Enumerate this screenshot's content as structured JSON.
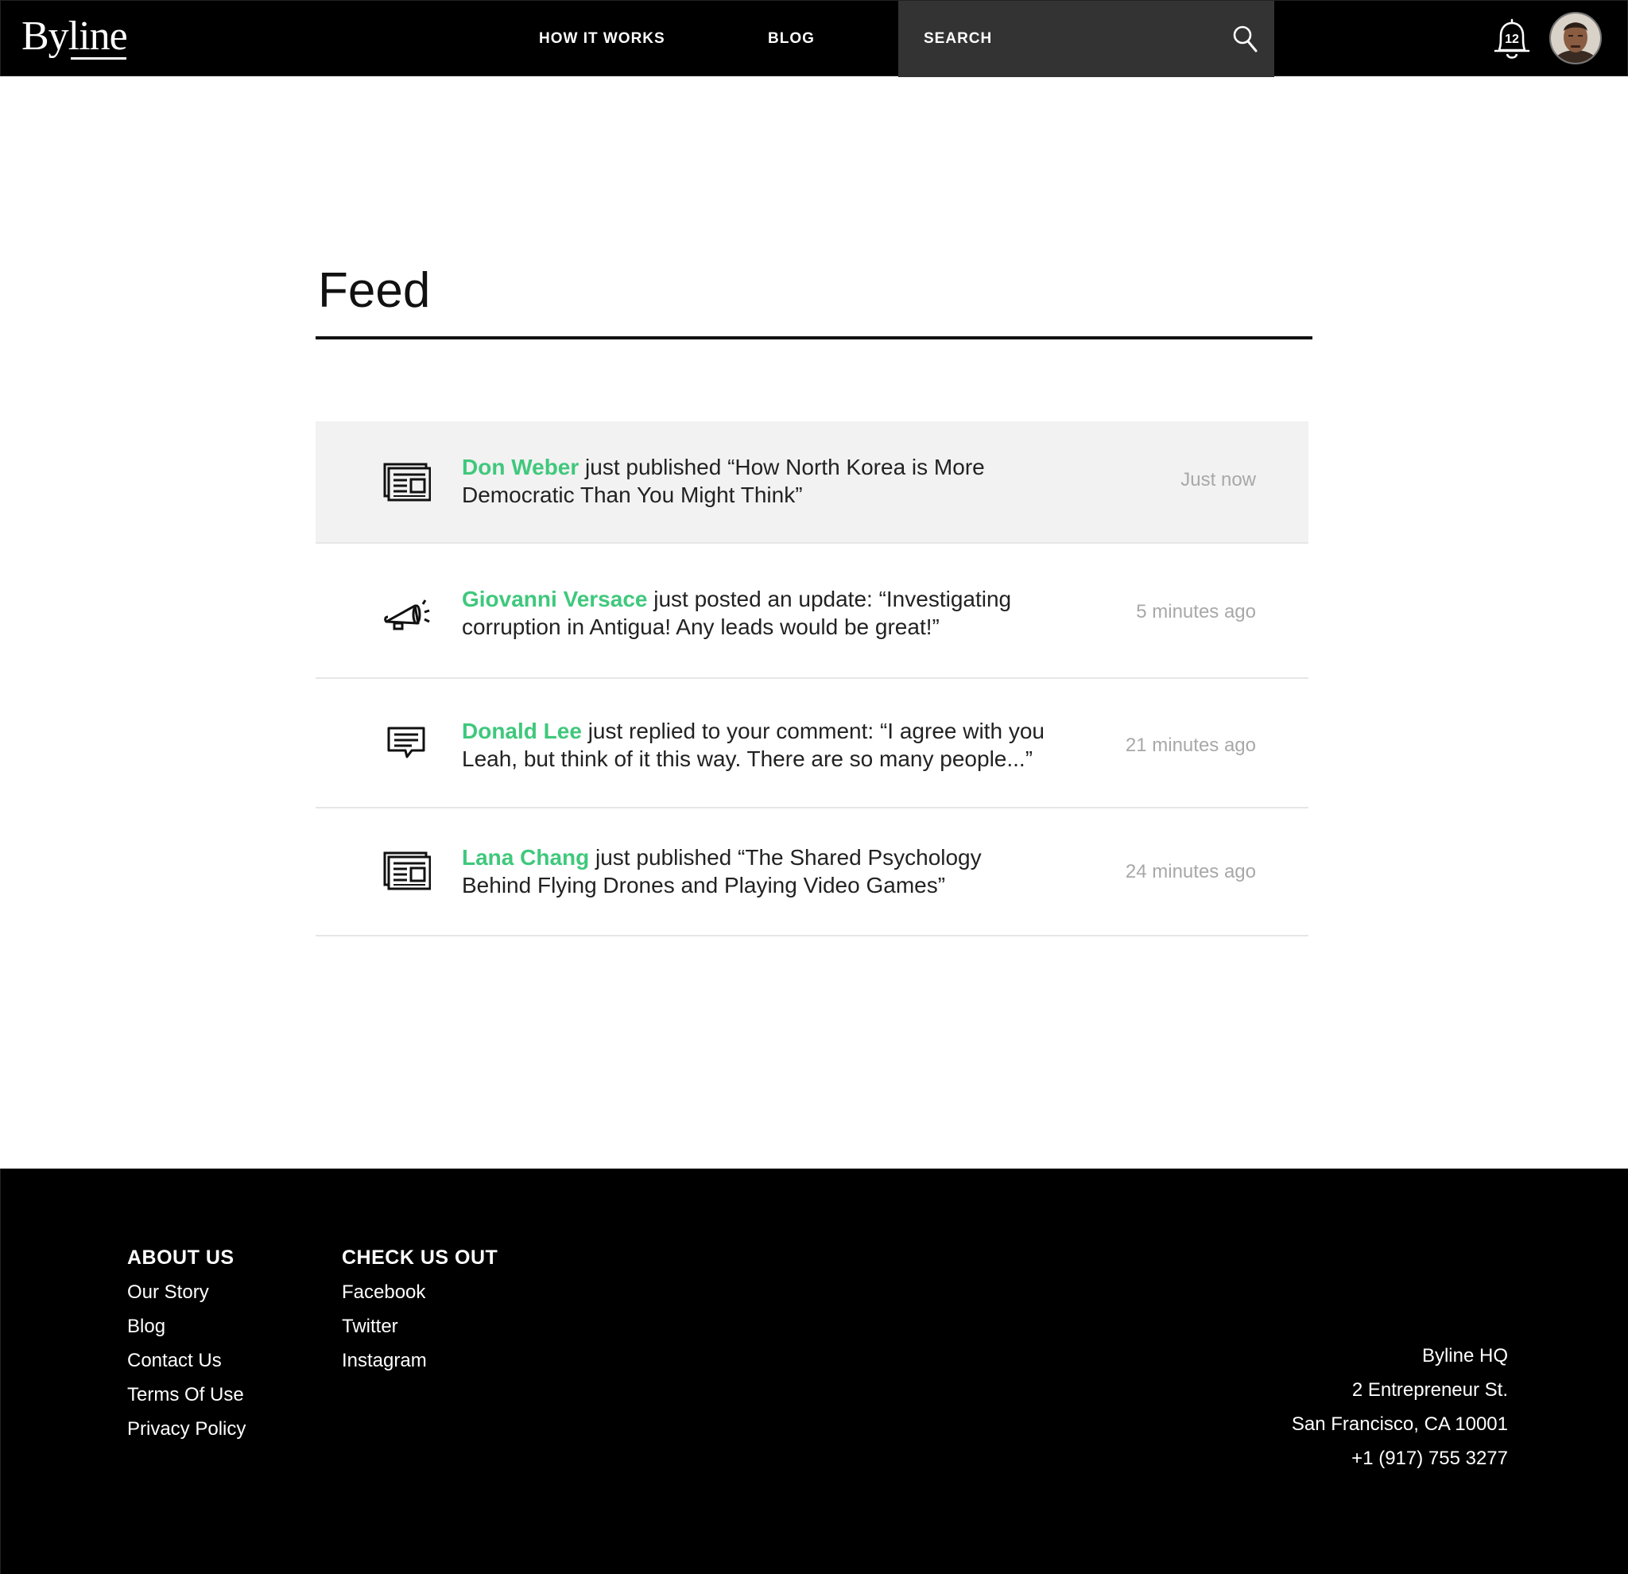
{
  "header": {
    "logo": "Byline",
    "nav": [
      "HOW IT WORKS",
      "BLOG"
    ],
    "search_label": "SEARCH",
    "notification_count": "12"
  },
  "main": {
    "title": "Feed",
    "items": [
      {
        "icon": "newspaper-icon",
        "actor": "Don Weber",
        "text": " just published “How North Korea is More Democratic Than You Might Think”",
        "time": "Just now"
      },
      {
        "icon": "megaphone-icon",
        "actor": "Giovanni Versace",
        "text": " just posted an update: “Investigating corruption in Antigua! Any leads would be great!”",
        "time": "5 minutes ago"
      },
      {
        "icon": "speech-bubble-icon",
        "actor": "Donald Lee",
        "text": " just replied to your comment: “I agree with you Leah, but think of it this way. There are so many people...”",
        "time": "21 minutes ago"
      },
      {
        "icon": "newspaper-icon",
        "actor": "Lana Chang",
        "text": " just published “The Shared Psychology Behind Flying Drones and Playing Video Games”",
        "time": "24 minutes ago"
      }
    ]
  },
  "footer": {
    "about_heading": "ABOUT US",
    "about_links": [
      "Our Story",
      "Blog",
      "Contact Us",
      "Terms Of Use",
      "Privacy Policy"
    ],
    "social_heading": "CHECK US OUT",
    "social_links": [
      "Facebook",
      "Twitter",
      "Instagram"
    ],
    "address": [
      "Byline HQ",
      "2 Entrepreneur St.",
      "San Francisco, CA 10001",
      "+1 (917) 755 3277"
    ]
  },
  "colors": {
    "accent": "#3fc87c",
    "header_bg": "#000000",
    "search_bg": "#333333",
    "active_row": "#f2f2f2"
  }
}
